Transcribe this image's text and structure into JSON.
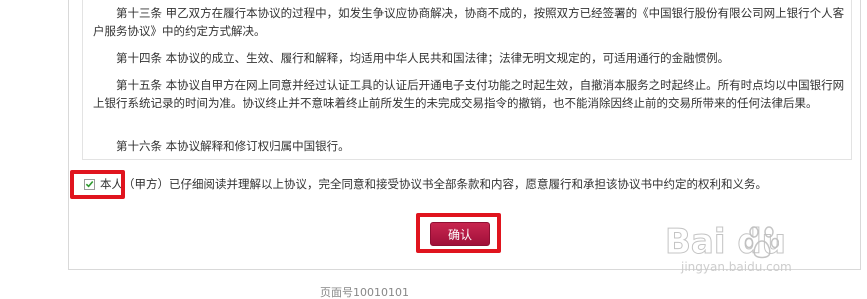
{
  "agreement": {
    "clauses": [
      "第十三条 甲乙双方在履行本协议的过程中，如发生争议应协商解决，协商不成的，按照双方已经签署的《中国银行股份有限公司网上银行个人客户服务协议》中的约定方式解决。",
      "第十四条 本协议的成立、生效、履行和解释，均适用中华人民共和国法律；法律无明文规定的，可适用通行的金融惯例。",
      "第十五条 本协议自甲方在网上同意并经过认证工具的认证后开通电子支付功能之时起生效，自撤消本服务之时起终止。所有时点均以中国银行网上银行系统记录的时间为准。协议终止并不意味着终止前所发生的未完成交易指令的撤销，也不能消除因终止前的交易所带来的任何法律后果。",
      "第十六条 本协议解释和修订权归属中国银行。"
    ]
  },
  "consent": {
    "checked": true,
    "label": "本人（甲方）已仔细阅读并理解以上协议，完全同意和接受协议书全部条款和内容，愿意履行和承担该协议书中约定的权利和义务。"
  },
  "actions": {
    "confirm_label": "确认"
  },
  "footer": {
    "page_number": "页面号10010101"
  },
  "watermark": {
    "logo_text": "Bai du",
    "sub_text": "jingyan.baidu.com"
  },
  "colors": {
    "highlight": "#e0141e",
    "button": "#b5173f",
    "check": "#2e9a2e"
  }
}
